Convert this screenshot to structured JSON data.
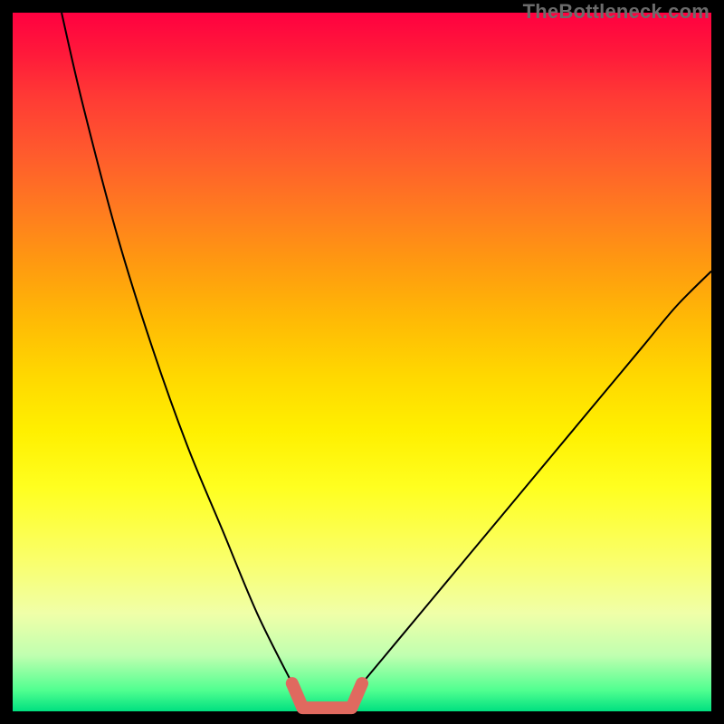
{
  "watermark": "TheBottleneck.com",
  "chart_data": {
    "type": "line",
    "title": "",
    "xlabel": "",
    "ylabel": "",
    "xlim": [
      0,
      100
    ],
    "ylim": [
      0,
      100
    ],
    "legend": false,
    "notes": "V-shaped bottleneck curve on rainbow gradient background. y-axis inverted visually: 0 (green, good) at bottom, 100 (red, bad) at top. Pink highlight marks flat optimal valley near x≈40-50.",
    "series": [
      {
        "name": "left-branch",
        "x": [
          7,
          10,
          15,
          20,
          25,
          30,
          35,
          40
        ],
        "y": [
          100,
          87,
          68,
          52,
          38,
          26,
          14,
          4
        ]
      },
      {
        "name": "right-branch",
        "x": [
          50,
          55,
          60,
          65,
          70,
          75,
          80,
          85,
          90,
          95,
          100
        ],
        "y": [
          4,
          10,
          16,
          22,
          28,
          34,
          40,
          46,
          52,
          58,
          63
        ]
      }
    ],
    "highlight": {
      "name": "optimal-region",
      "color": "#e0695f",
      "x": [
        40,
        41.5,
        48.5,
        50
      ],
      "y": [
        4,
        0.5,
        0.5,
        4
      ]
    },
    "gradient_stops": [
      {
        "pos": 0,
        "color": "#ff0040"
      },
      {
        "pos": 50,
        "color": "#ffe000"
      },
      {
        "pos": 100,
        "color": "#00e080"
      }
    ]
  }
}
